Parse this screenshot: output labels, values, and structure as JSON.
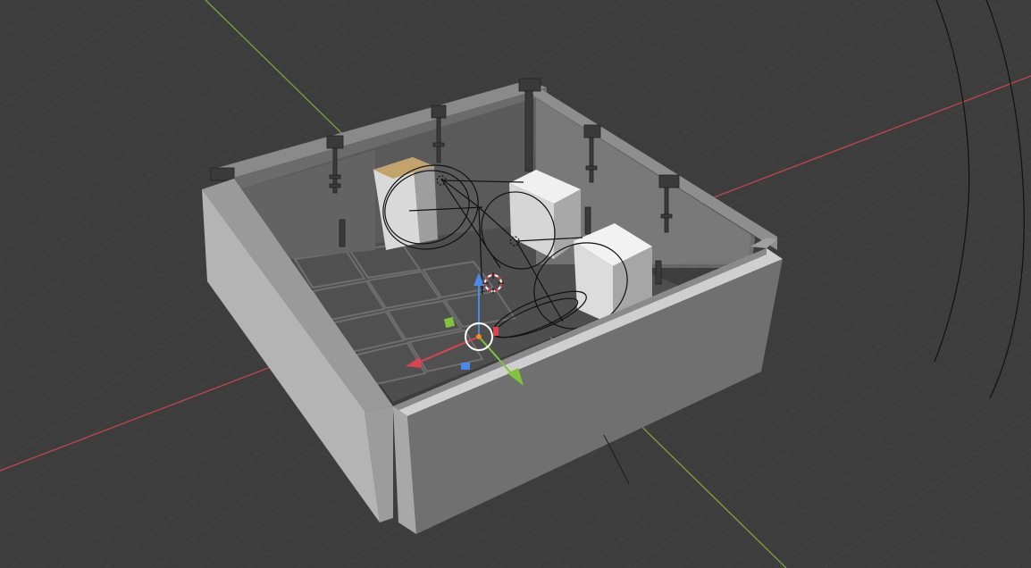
{
  "viewport": {
    "editor": "3D Viewport",
    "background_color": "#3d3d3d",
    "grid_line_color": "#474747",
    "axis_x_color": "#c0464e",
    "axis_y_color": "#7ea33b"
  },
  "scene": {
    "objects": [
      "room-walls",
      "floor-tiles",
      "box-1",
      "box-2",
      "box-3",
      "curve-ellipses",
      "wall-brackets"
    ]
  },
  "gizmo": {
    "type": "translate",
    "x_color": "#d9444e",
    "y_color": "#7fc43a",
    "z_color": "#4a8ae6",
    "origin_color": "#f08a1c"
  },
  "cursor_3d": {
    "color_red": "#d03030",
    "color_white": "#ffffff"
  }
}
